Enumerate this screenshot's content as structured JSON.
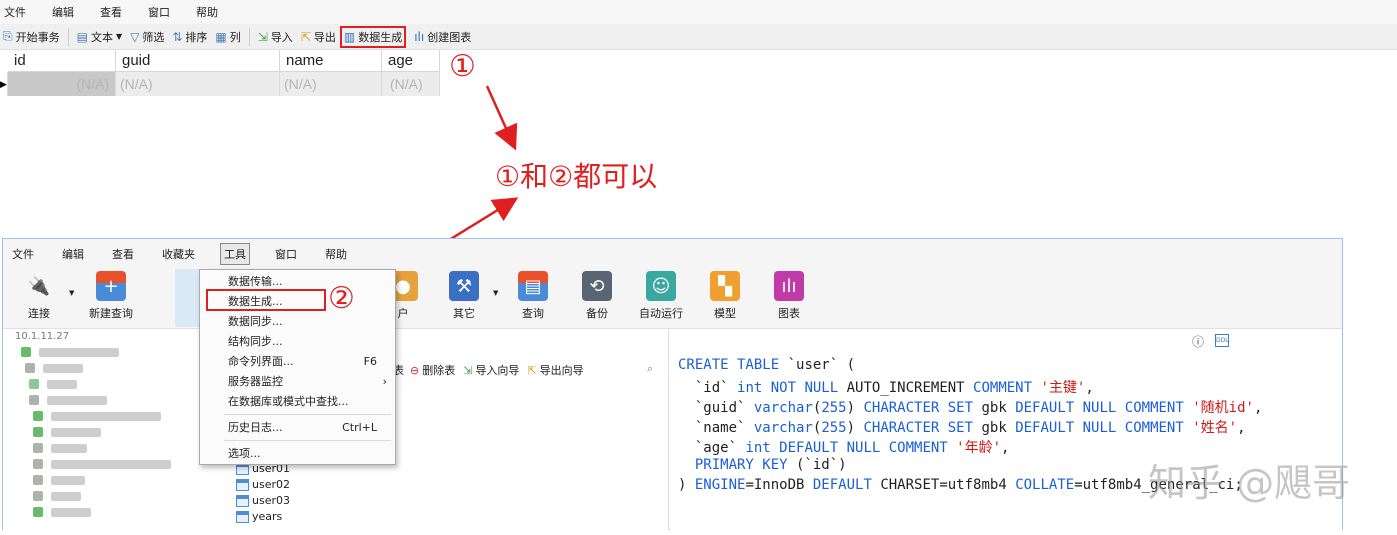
{
  "top": {
    "menu": [
      "文件",
      "编辑",
      "查看",
      "窗口",
      "帮助"
    ],
    "toolbar": {
      "begin_tx": "开始事务",
      "text": "文本",
      "filter": "筛选",
      "sort": "排序",
      "column": "列",
      "import": "导入",
      "export": "导出",
      "data_gen": "数据生成",
      "create_chart": "创建图表"
    },
    "grid": {
      "columns": [
        "id",
        "guid",
        "name",
        "age"
      ],
      "row": [
        "(N/A)",
        "(N/A)",
        "(N/A)",
        "(N/A)"
      ]
    }
  },
  "annotations": {
    "marker1": "①",
    "marker2": "②",
    "note": "①和②都可以",
    "color": "#e02020"
  },
  "bottom": {
    "menu": [
      "文件",
      "编辑",
      "查看",
      "收藏夹",
      "工具",
      "窗口",
      "帮助"
    ],
    "toolbar": {
      "connect": "连接",
      "new_query": "新建查询",
      "user": "户",
      "other": "其它",
      "query": "查询",
      "backup": "备份",
      "auto_run": "自动运行",
      "model": "模型",
      "chart": "图表"
    },
    "tools_menu": {
      "items": [
        "数据传输...",
        "数据生成...",
        "数据同步...",
        "结构同步...",
        "命令列界面...",
        "服务器监控",
        "在数据库或模式中查找...",
        "历史日志...",
        "选项..."
      ],
      "shortcuts": {
        "cmd": "F6",
        "history": "Ctrl+L"
      },
      "submenu_arrow": "›"
    },
    "tree_top": "10.1.11.27",
    "obj_toolbar": {
      "partial": "表",
      "delete_table": "删除表",
      "import_wizard": "导入向导",
      "export_wizard": "导出向导"
    },
    "tables": [
      "user01",
      "user02",
      "user03",
      "years"
    ],
    "sql": {
      "line1": [
        "CREATE TABLE",
        " `user` ("
      ],
      "line2": [
        "  `id` ",
        "int NOT NULL",
        " AUTO_INCREMENT ",
        "COMMENT",
        " ",
        "'主键'",
        ","
      ],
      "line3": [
        "  `guid` ",
        "varchar",
        "(",
        "255",
        ") ",
        "CHARACTER SET",
        " gbk ",
        "DEFAULT NULL COMMENT",
        " ",
        "'随机id'",
        ","
      ],
      "line4": [
        "  `name` ",
        "varchar",
        "(",
        "255",
        ") ",
        "CHARACTER SET",
        " gbk ",
        "DEFAULT NULL COMMENT",
        " ",
        "'姓名'",
        ","
      ],
      "line5": [
        "  `age` ",
        "int DEFAULT NULL COMMENT",
        " ",
        "'年龄'",
        ","
      ],
      "line6": [
        "  ",
        "PRIMARY KEY",
        " (`id`)"
      ],
      "line7": [
        ") ",
        "ENGINE",
        "=InnoDB ",
        "DEFAULT",
        " CHARSET=utf8mb4 ",
        "COLLATE",
        "=utf8mb4_general_ci;"
      ]
    }
  },
  "watermark": "知乎 @飓哥"
}
